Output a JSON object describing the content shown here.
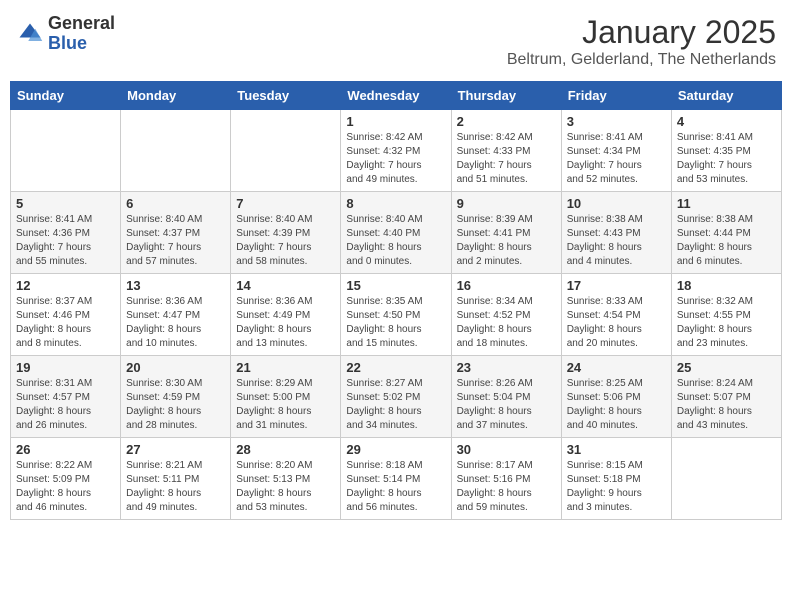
{
  "header": {
    "logo_general": "General",
    "logo_blue": "Blue",
    "title": "January 2025",
    "subtitle": "Beltrum, Gelderland, The Netherlands"
  },
  "weekdays": [
    "Sunday",
    "Monday",
    "Tuesday",
    "Wednesday",
    "Thursday",
    "Friday",
    "Saturday"
  ],
  "weeks": [
    [
      {
        "day": "",
        "info": ""
      },
      {
        "day": "",
        "info": ""
      },
      {
        "day": "",
        "info": ""
      },
      {
        "day": "1",
        "info": "Sunrise: 8:42 AM\nSunset: 4:32 PM\nDaylight: 7 hours\nand 49 minutes."
      },
      {
        "day": "2",
        "info": "Sunrise: 8:42 AM\nSunset: 4:33 PM\nDaylight: 7 hours\nand 51 minutes."
      },
      {
        "day": "3",
        "info": "Sunrise: 8:41 AM\nSunset: 4:34 PM\nDaylight: 7 hours\nand 52 minutes."
      },
      {
        "day": "4",
        "info": "Sunrise: 8:41 AM\nSunset: 4:35 PM\nDaylight: 7 hours\nand 53 minutes."
      }
    ],
    [
      {
        "day": "5",
        "info": "Sunrise: 8:41 AM\nSunset: 4:36 PM\nDaylight: 7 hours\nand 55 minutes."
      },
      {
        "day": "6",
        "info": "Sunrise: 8:40 AM\nSunset: 4:37 PM\nDaylight: 7 hours\nand 57 minutes."
      },
      {
        "day": "7",
        "info": "Sunrise: 8:40 AM\nSunset: 4:39 PM\nDaylight: 7 hours\nand 58 minutes."
      },
      {
        "day": "8",
        "info": "Sunrise: 8:40 AM\nSunset: 4:40 PM\nDaylight: 8 hours\nand 0 minutes."
      },
      {
        "day": "9",
        "info": "Sunrise: 8:39 AM\nSunset: 4:41 PM\nDaylight: 8 hours\nand 2 minutes."
      },
      {
        "day": "10",
        "info": "Sunrise: 8:38 AM\nSunset: 4:43 PM\nDaylight: 8 hours\nand 4 minutes."
      },
      {
        "day": "11",
        "info": "Sunrise: 8:38 AM\nSunset: 4:44 PM\nDaylight: 8 hours\nand 6 minutes."
      }
    ],
    [
      {
        "day": "12",
        "info": "Sunrise: 8:37 AM\nSunset: 4:46 PM\nDaylight: 8 hours\nand 8 minutes."
      },
      {
        "day": "13",
        "info": "Sunrise: 8:36 AM\nSunset: 4:47 PM\nDaylight: 8 hours\nand 10 minutes."
      },
      {
        "day": "14",
        "info": "Sunrise: 8:36 AM\nSunset: 4:49 PM\nDaylight: 8 hours\nand 13 minutes."
      },
      {
        "day": "15",
        "info": "Sunrise: 8:35 AM\nSunset: 4:50 PM\nDaylight: 8 hours\nand 15 minutes."
      },
      {
        "day": "16",
        "info": "Sunrise: 8:34 AM\nSunset: 4:52 PM\nDaylight: 8 hours\nand 18 minutes."
      },
      {
        "day": "17",
        "info": "Sunrise: 8:33 AM\nSunset: 4:54 PM\nDaylight: 8 hours\nand 20 minutes."
      },
      {
        "day": "18",
        "info": "Sunrise: 8:32 AM\nSunset: 4:55 PM\nDaylight: 8 hours\nand 23 minutes."
      }
    ],
    [
      {
        "day": "19",
        "info": "Sunrise: 8:31 AM\nSunset: 4:57 PM\nDaylight: 8 hours\nand 26 minutes."
      },
      {
        "day": "20",
        "info": "Sunrise: 8:30 AM\nSunset: 4:59 PM\nDaylight: 8 hours\nand 28 minutes."
      },
      {
        "day": "21",
        "info": "Sunrise: 8:29 AM\nSunset: 5:00 PM\nDaylight: 8 hours\nand 31 minutes."
      },
      {
        "day": "22",
        "info": "Sunrise: 8:27 AM\nSunset: 5:02 PM\nDaylight: 8 hours\nand 34 minutes."
      },
      {
        "day": "23",
        "info": "Sunrise: 8:26 AM\nSunset: 5:04 PM\nDaylight: 8 hours\nand 37 minutes."
      },
      {
        "day": "24",
        "info": "Sunrise: 8:25 AM\nSunset: 5:06 PM\nDaylight: 8 hours\nand 40 minutes."
      },
      {
        "day": "25",
        "info": "Sunrise: 8:24 AM\nSunset: 5:07 PM\nDaylight: 8 hours\nand 43 minutes."
      }
    ],
    [
      {
        "day": "26",
        "info": "Sunrise: 8:22 AM\nSunset: 5:09 PM\nDaylight: 8 hours\nand 46 minutes."
      },
      {
        "day": "27",
        "info": "Sunrise: 8:21 AM\nSunset: 5:11 PM\nDaylight: 8 hours\nand 49 minutes."
      },
      {
        "day": "28",
        "info": "Sunrise: 8:20 AM\nSunset: 5:13 PM\nDaylight: 8 hours\nand 53 minutes."
      },
      {
        "day": "29",
        "info": "Sunrise: 8:18 AM\nSunset: 5:14 PM\nDaylight: 8 hours\nand 56 minutes."
      },
      {
        "day": "30",
        "info": "Sunrise: 8:17 AM\nSunset: 5:16 PM\nDaylight: 8 hours\nand 59 minutes."
      },
      {
        "day": "31",
        "info": "Sunrise: 8:15 AM\nSunset: 5:18 PM\nDaylight: 9 hours\nand 3 minutes."
      },
      {
        "day": "",
        "info": ""
      }
    ]
  ]
}
